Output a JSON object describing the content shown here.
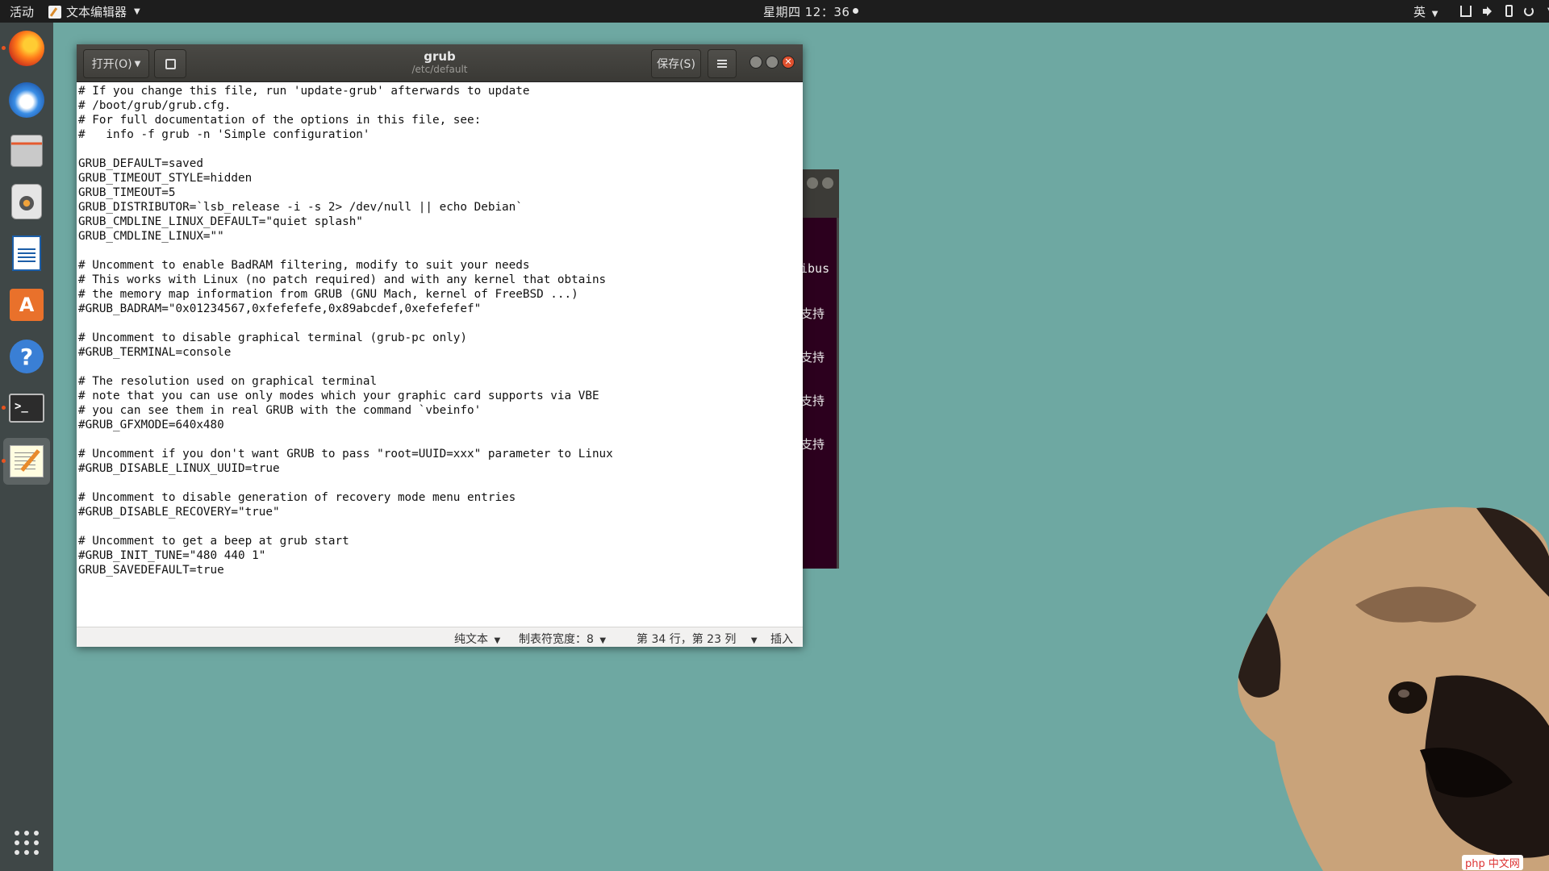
{
  "topbar": {
    "activities": "活动",
    "app_name": "文本编辑器",
    "clock": "星期四 12：36",
    "input_method": "英"
  },
  "dock": {
    "items": [
      "firefox-icon",
      "thunderbird-icon",
      "files-icon",
      "rhythmbox-icon",
      "libreoffice-writer-icon",
      "software-center-icon",
      "help-icon",
      "terminal-icon",
      "text-editor-icon"
    ],
    "terminal_glyph": ">_"
  },
  "gedit": {
    "open_label": "打开(O)",
    "save_label": "保存(S)",
    "title": "grub",
    "subtitle": "/etc/default",
    "close_glyph": "✕",
    "content": [
      "# If you change this file, run 'update-grub' afterwards to update",
      "# /boot/grub/grub.cfg.",
      "# For full documentation of the options in this file, see:",
      "#   info -f grub -n 'Simple configuration'",
      "",
      "GRUB_DEFAULT=saved",
      "GRUB_TIMEOUT_STYLE=hidden",
      "GRUB_TIMEOUT=5",
      "GRUB_DISTRIBUTOR=`lsb_release -i -s 2> /dev/null || echo Debian`",
      "GRUB_CMDLINE_LINUX_DEFAULT=\"quiet splash\"",
      "GRUB_CMDLINE_LINUX=\"\"",
      "",
      "# Uncomment to enable BadRAM filtering, modify to suit your needs",
      "# This works with Linux (no patch required) and with any kernel that obtains",
      "# the memory map information from GRUB (GNU Mach, kernel of FreeBSD ...)",
      "#GRUB_BADRAM=\"0x01234567,0xfefefefe,0x89abcdef,0xefefefef\"",
      "",
      "# Uncomment to disable graphical terminal (grub-pc only)",
      "#GRUB_TERMINAL=console",
      "",
      "# The resolution used on graphical terminal",
      "# note that you can use only modes which your graphic card supports via VBE",
      "# you can see them in real GRUB with the command `vbeinfo'",
      "#GRUB_GFXMODE=640x480",
      "",
      "# Uncomment if you don't want GRUB to pass \"root=UUID=xxx\" parameter to Linux",
      "#GRUB_DISABLE_LINUX_UUID=true",
      "",
      "# Uncomment to disable generation of recovery mode menu entries",
      "#GRUB_DISABLE_RECOVERY=\"true\"",
      "",
      "# Uncomment to get a beep at grub start",
      "#GRUB_INIT_TUNE=\"480 440 1\"",
      "GRUB_SAVEDEFAULT=true"
    ],
    "status": {
      "language": "纯文本",
      "tab_width": "制表符宽度：8",
      "position": "第 34 行，第 23 列",
      "mode": "插入"
    }
  },
  "terminal_bg": {
    "lines": [
      "ibus",
      "支持",
      "支持",
      "支持",
      "支持"
    ]
  },
  "watermark": "php 中文网",
  "colors": {
    "desktop": "#6ea8a2",
    "topbar": "#1d1d1d",
    "dock": "#3f4747",
    "accent": "#e95420",
    "terminal": "#2c001e"
  }
}
